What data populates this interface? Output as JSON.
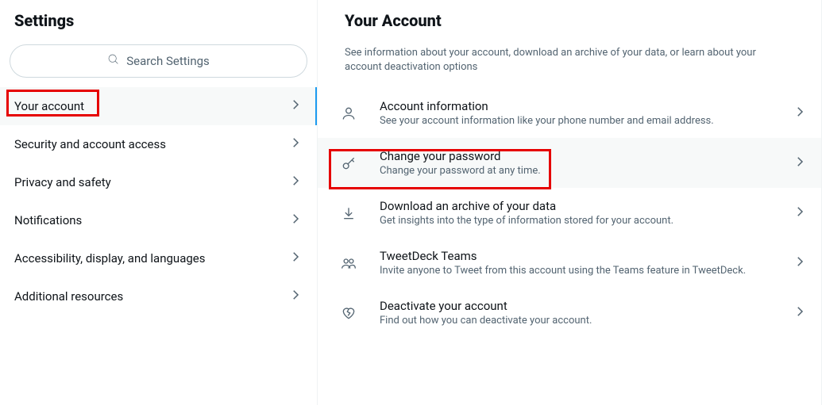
{
  "sidebar": {
    "title": "Settings",
    "search_placeholder": "Search Settings",
    "items": [
      {
        "label": "Your account"
      },
      {
        "label": "Security and account access"
      },
      {
        "label": "Privacy and safety"
      },
      {
        "label": "Notifications"
      },
      {
        "label": "Accessibility, display, and languages"
      },
      {
        "label": "Additional resources"
      }
    ]
  },
  "main": {
    "title": "Your Account",
    "subtitle": "See information about your account, download an archive of your data, or learn about your account deactivation options",
    "options": [
      {
        "title": "Account information",
        "desc": "See your account information like your phone number and email address."
      },
      {
        "title": "Change your password",
        "desc": "Change your password at any time."
      },
      {
        "title": "Download an archive of your data",
        "desc": "Get insights into the type of information stored for your account."
      },
      {
        "title": "TweetDeck Teams",
        "desc": "Invite anyone to Tweet from this account using the Teams feature in TweetDeck."
      },
      {
        "title": "Deactivate your account",
        "desc": "Find out how you can deactivate your account."
      }
    ]
  }
}
